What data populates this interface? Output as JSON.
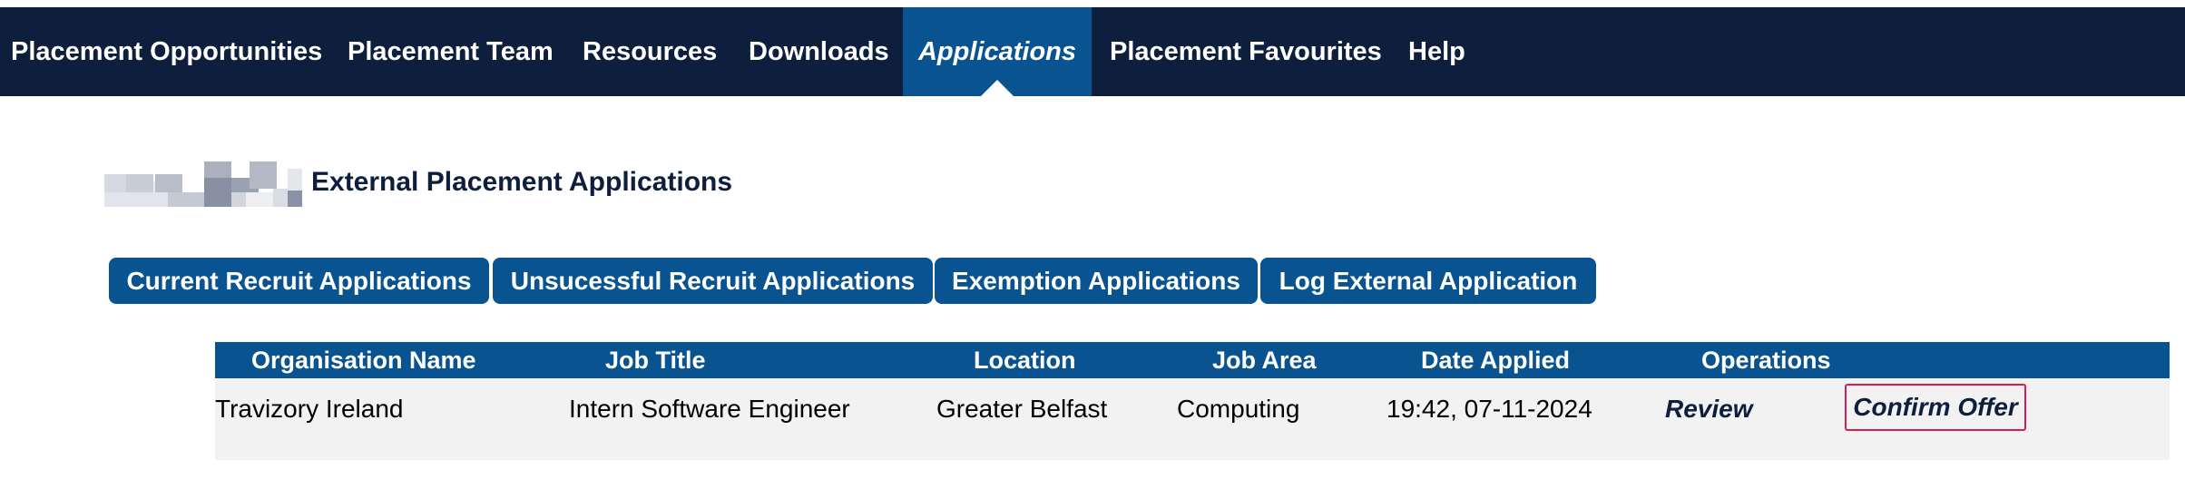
{
  "nav": {
    "items": [
      {
        "label": "Placement Opportunities"
      },
      {
        "label": "Placement Team"
      },
      {
        "label": "Resources"
      },
      {
        "label": "Downloads"
      },
      {
        "label": "Applications",
        "active": true
      },
      {
        "label": "Placement Favourites"
      },
      {
        "label": "Help"
      }
    ]
  },
  "page": {
    "title": "External Placement Applications"
  },
  "tabs": [
    {
      "label": "Current Recruit Applications"
    },
    {
      "label": "Unsucessful Recruit Applications"
    },
    {
      "label": "Exemption Applications"
    },
    {
      "label": "Log External Application"
    }
  ],
  "table": {
    "headers": [
      "Organisation Name",
      "Job Title",
      "Location",
      "Job Area",
      "Date Applied",
      "Operations"
    ],
    "rows": [
      {
        "organisation": "Travizory Ireland",
        "job_title": "Intern Software Engineer",
        "location": "Greater Belfast",
        "job_area": "Computing",
        "date_applied": "19:42, 07-11-2024",
        "review_label": "Review",
        "confirm_label": "Confirm Offer"
      }
    ]
  },
  "colors": {
    "nav_bg": "#0d1f3c",
    "accent": "#0a5391",
    "confirm_border": "#d81b50",
    "row_bg": "#f2f2f2"
  }
}
